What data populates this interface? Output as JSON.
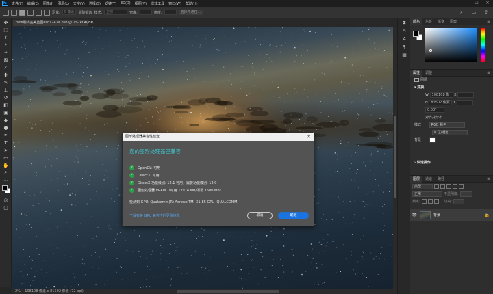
{
  "app": {
    "logo": "Ps"
  },
  "menubar": {
    "items": [
      "文件(F)",
      "编辑(E)",
      "图像(I)",
      "图层(L)",
      "文字(Y)",
      "选择(S)",
      "滤镜(T)",
      "3D(D)",
      "视图(V)",
      "增效工具",
      "窗口(W)",
      "帮助(H)"
    ],
    "window_controls": [
      "—",
      "☐",
      "✕"
    ]
  },
  "optionsbar": {
    "feather_label": "羽化:",
    "feather_value": "0 像素",
    "antialias_label": "消除锯齿",
    "style_label": "样式:",
    "style_value": "正常",
    "width_label": "宽度:",
    "height_label": "高度:",
    "select_mask_label": "选择并遮住..."
  },
  "document": {
    "tab_title": "new最终完美蓝图eso1242a.psb @ 2%(RGB/8#)",
    "tab_close": "×"
  },
  "statusbar": {
    "zoom": "2%",
    "doc_size": "108108 像素 x 81502 像素 (72 ppi)"
  },
  "panels": {
    "color_tabs": [
      "颜色",
      "色板",
      "渐变",
      "图案"
    ],
    "props_tabs": [
      "属性",
      "调整"
    ],
    "props": {
      "layer_type": "图层",
      "section_transform": "变换",
      "w_label": "W",
      "w_value": "108108 像",
      "x_label": "X",
      "h_label": "H",
      "h_value": "81502 像素",
      "y_label": "Y",
      "angle": "0.00°",
      "section_align": "对齐并分布",
      "mode_label": "模式",
      "mode_value": "RGB 颜色",
      "bit_value": "8 位/通道",
      "bg_label": "背景",
      "quick_actions": "快速操作"
    },
    "layers_tabs": [
      "图层",
      "通道",
      "路径"
    ],
    "layers": {
      "kind_label": "类型",
      "blend_mode": "正常",
      "opacity_label": "不透明度:",
      "lock_label": "锁定:",
      "fill_label": "填充:",
      "layer_name": "背景",
      "eye": "👁",
      "lock": "🔒"
    }
  },
  "dialog": {
    "title": "图形处理器兼容性检查",
    "close": "✕",
    "heading": "您的图形处理器已兼容",
    "checks": [
      "OpenGL: 可用",
      "DirectX: 可用",
      "DirectX 功能级别: 12.1 可用，需要功能级别: 12.0",
      "图形处理器 VRAM （可用 17974 MB/所需 1500 MB）"
    ],
    "gpu_line": "检测到 GPU: Qualcomm(R) Adreno(TM) X1-85 GPU (QUALCOMM)",
    "link": "了解有关 GPU 兼容性的更多信息",
    "cancel": "取消",
    "ok": "确定",
    "check_color": "#2d9d4a",
    "heading_color": "#3ec3c9",
    "ok_color": "#1a73e0"
  }
}
